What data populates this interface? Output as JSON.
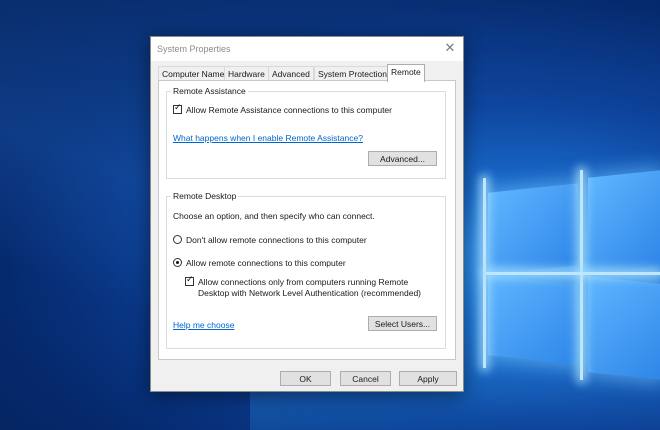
{
  "window": {
    "title": "System Properties",
    "close_icon": "close-icon"
  },
  "tabs": [
    {
      "label": "Computer Name"
    },
    {
      "label": "Hardware"
    },
    {
      "label": "Advanced"
    },
    {
      "label": "System Protection"
    },
    {
      "label": "Remote",
      "active": true
    }
  ],
  "remote_assistance": {
    "group_label": "Remote Assistance",
    "allow_checkbox_label": "Allow Remote Assistance connections to this computer",
    "allow_checked": true,
    "help_link": "What happens when I enable Remote Assistance?",
    "advanced_button": "Advanced..."
  },
  "remote_desktop": {
    "group_label": "Remote Desktop",
    "instruction": "Choose an option, and then specify who can connect.",
    "option_dont_allow": "Don't allow remote connections to this computer",
    "option_allow": "Allow remote connections to this computer",
    "selected_option": "allow",
    "nla_checkbox_line1": "Allow connections only from computers running Remote",
    "nla_checkbox_line2": "Desktop with Network Level Authentication (recommended)",
    "nla_checked": true,
    "help_link": "Help me choose",
    "select_users_button": "Select Users..."
  },
  "footer": {
    "ok": "OK",
    "cancel": "Cancel",
    "apply": "Apply"
  }
}
